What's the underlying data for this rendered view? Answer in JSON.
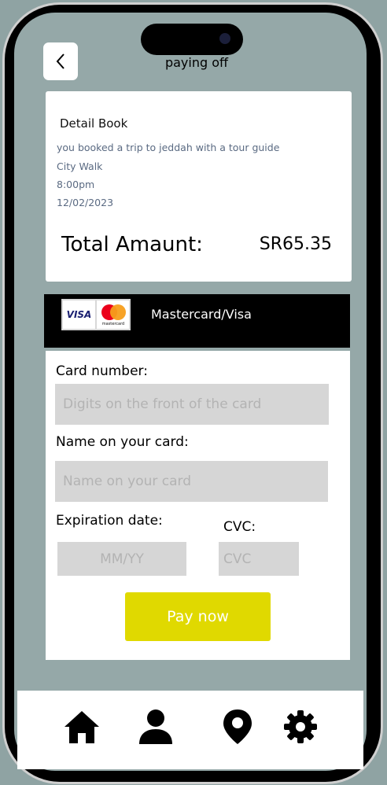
{
  "header": {
    "title": "paying off",
    "back_icon": "chevron-left-icon"
  },
  "booking": {
    "title": "Detail Book",
    "description": "you booked a trip to jeddah with a tour guide",
    "location": "City Walk",
    "time": "8:00pm",
    "date": "12/02/2023",
    "total_label": "Total Amaunt:",
    "total_value": "SR65.35"
  },
  "payment_method": {
    "visa_text": "VISA",
    "mastercard_text": "mastercard",
    "label": "Mastercard/Visa"
  },
  "form": {
    "card_number_label": "Card number:",
    "card_number_placeholder": "Digits on the front of the card",
    "card_name_label": "Name on your card:",
    "card_name_placeholder": "Name on your card",
    "expiration_label": "Expiration date:",
    "expiration_placeholder": "MM/YY",
    "cvc_label": "CVC:",
    "cvc_placeholder": "CVC",
    "pay_button": "Pay now"
  },
  "bottom_nav": {
    "items": [
      {
        "icon": "home-icon"
      },
      {
        "icon": "user-icon"
      },
      {
        "icon": "location-pin-icon"
      },
      {
        "icon": "gear-icon"
      }
    ]
  },
  "colors": {
    "background": "#95a8a8",
    "pay_button": "#e0d900",
    "input_bg": "#d6d6d6",
    "header_bar": "#000000"
  }
}
